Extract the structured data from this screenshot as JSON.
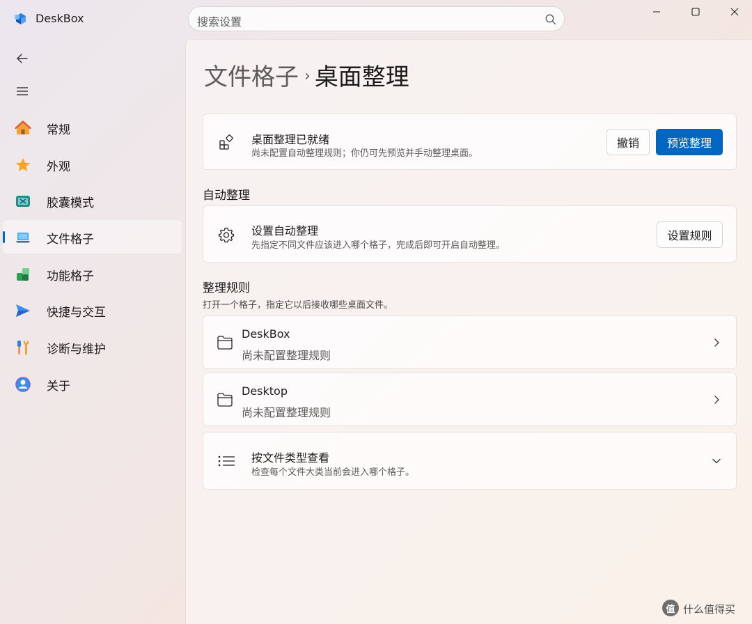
{
  "app": {
    "name": "DeskBox",
    "search_placeholder": "搜索设置"
  },
  "sidebar": {
    "items": [
      {
        "label": "常规",
        "icon": "home-icon"
      },
      {
        "label": "外观",
        "icon": "star-icon"
      },
      {
        "label": "胶囊模式",
        "icon": "capsule-icon"
      },
      {
        "label": "文件格子",
        "icon": "laptop-icon",
        "selected": true
      },
      {
        "label": "功能格子",
        "icon": "blocks-icon"
      },
      {
        "label": "快捷与交互",
        "icon": "send-icon"
      },
      {
        "label": "诊断与维护",
        "icon": "tools-icon"
      },
      {
        "label": "关于",
        "icon": "info-icon"
      }
    ]
  },
  "breadcrumb": {
    "parent": "文件格子",
    "current": "桌面整理"
  },
  "status_card": {
    "title": "桌面整理已就绪",
    "description": "尚未配置自动整理规则；你仍可先预览并手动整理桌面。",
    "undo_label": "撤销",
    "preview_label": "预览整理"
  },
  "auto_section": {
    "heading": "自动整理",
    "card_title": "设置自动整理",
    "card_description": "先指定不同文件应该进入哪个格子，完成后即可开启自动整理。",
    "button_label": "设置规则"
  },
  "rules_section": {
    "heading": "整理规则",
    "subtitle": "打开一个格子，指定它以后接收哪些桌面文件。",
    "fences": [
      {
        "name": "DeskBox",
        "status": "尚未配置整理规则"
      },
      {
        "name": "Desktop",
        "status": "尚未配置整理规则"
      }
    ],
    "by_type": {
      "title": "按文件类型查看",
      "description": "检查每个文件大类当前会进入哪个格子。"
    }
  },
  "watermark": {
    "badge": "值",
    "text": "什么值得买"
  },
  "colors": {
    "accent": "#0067c0"
  }
}
